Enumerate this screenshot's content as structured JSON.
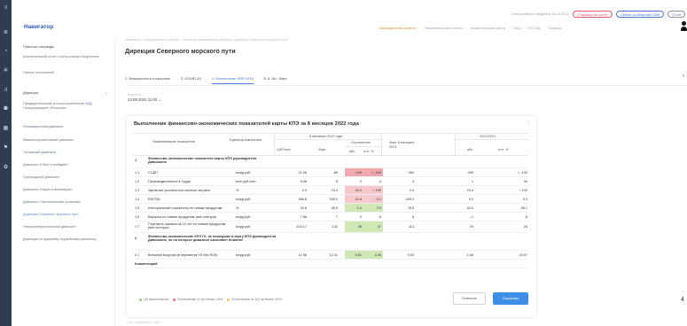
{
  "rail": {
    "icons": [
      "menu-icon",
      "list-icon",
      "pie-chart-icon",
      "cog-icon",
      "chart-icon",
      "people-icon",
      "dashboard-icon",
      "flag-icon",
      "settings-icon"
    ]
  },
  "header": {
    "status_text": "Оперативные сведения 18.10.2022",
    "pills": [
      "Отправка на успех",
      "Обмен сообщений СМИ",
      "Сооб"
    ],
    "app_title": "Навигатор",
    "nav": [
      "Операционный комитет",
      "Управленческие отчеты",
      "Аналитический центр",
      "ОКЦ",
      "ЕССЭД",
      "Помощь"
    ]
  },
  "sidebar": {
    "items": [
      "Повестка операнды",
      "Аналитический отчет о контрольных поручениях",
      "Панель отклонений",
      "Дирекции",
      "Предварительный прогноз исполнения ОЛД Госкорпорацией «Росатом»",
      "Инновационная дивизион",
      "Машиностроительный дивизион",
      "Топливный дивизион",
      "Дивизион «Сбыт и трейдинг»",
      "Горнорудный дивизион",
      "Дивизион «Наука и инновации»",
      "Дивизион «Экологические решения»",
      "Дирекция Северного морского пути",
      "Электроэнергетический дивизион",
      "Дирекция по ядерному оружейному комплексу"
    ]
  },
  "breadcrumb": "Навигатор  /  Операционный комитет  /  Основные направления бизнеса  /  Дирекция Северного морского пути",
  "page_title": "Дирекция Северного морского пути",
  "tabs": [
    "2. Безопасность и качество",
    "3. COVID-19",
    "4. Выполнение ФЭП КПЭ",
    "5. 6. 6А - Факт"
  ],
  "date": {
    "label": "Версия от",
    "value": "23.08.2022 11:00"
  },
  "card": {
    "title": "Выполнение финансово-экономических показателей карты КПЭ за 8 месяцев 2022 года",
    "headers": {
      "name": "Наименование показателя",
      "unit": "Единица измерения",
      "period": "8 месяцев 2022 года",
      "plan": "ЦЗ/План",
      "fact": "Факт",
      "deviation": "Отклонение",
      "abs": "абс.",
      "pct": "отн. %",
      "fact_prev": "Факт 8 месяцев 2021",
      "compare": "2022/2021",
      "abs2": "абс.",
      "pct2": "отн. %"
    },
    "rows": [
      {
        "idx": "1",
        "name": "Финансово-экономические показатели карты КПЭ руководителя Дивизиона",
        "section": true
      },
      {
        "idx": "1.1",
        "name": "ССДП",
        "unit": "млрд руб.",
        "plan": "21.08",
        "fact": "-89",
        "abs": "-109",
        "pct": "< -100",
        "prev": "360",
        "abs2": "-430",
        "pct2": "< -100"
      },
      {
        "idx": "1.2",
        "name": "Производительность труда",
        "unit": "млн руб./чел",
        "plan": "5.08",
        "fact": "5",
        "abs": "0",
        "pct": "-4",
        "prev": "4",
        "abs2": "1",
        "pct2": "34"
      },
      {
        "idx": "1.3",
        "name": "Удельные условно-постоянные затраты",
        "unit": "%",
        "plan": "0.0",
        "fact": "23.4",
        "abs": "23.4",
        "pct": "> 100",
        "prev": "0.0",
        "abs2": "23.4",
        "pct2": "> 100"
      },
      {
        "idx": "1.4",
        "name": "EBITDA",
        "unit": "млрд руб.",
        "plan": "356.8",
        "fact": "345.0",
        "abs": "-11.8",
        "pct": "-3.1",
        "prev": "345.0",
        "abs2": "0.0",
        "pct2": "0.0"
      },
      {
        "idx": "1.5",
        "name": "Интегральный показатель по новым продуктам",
        "unit": "%",
        "plan": "34.8",
        "fact": "35.5",
        "abs": "1.0",
        "pct": "2.9",
        "prev": "78.5",
        "abs2": "-43.0",
        "pct2": "-55.1"
      },
      {
        "idx": "1.6",
        "name": "Выручка по новым продуктам (вне контура)",
        "unit": "млрд руб.",
        "plan": "7.88",
        "fact": "7",
        "abs": "0",
        "pct": "-5",
        "prev": "8",
        "abs2": "-1",
        "pct2": "-6"
      },
      {
        "idx": "1.7",
        "name": "Портфель заказов на 10 лет по новым продуктам (вне контура)",
        "unit": "млрд руб.",
        "plan": "104.17",
        "fact": "142",
        "abs": "38",
        "pct": "37",
        "prev": "113",
        "abs2": "29",
        "pct2": "26"
      },
      {
        "idx": "2",
        "name": "Финансово-экономические КПЭ ГК, не вошедшие в карту КПЭ руководителя Дивизиона, но на которые дивизион оказывает влияние",
        "section": true
      },
      {
        "idx": "2.1",
        "name": "Внешняя выручка (в периметре ГК без ЯОК)",
        "unit": "млрд руб.",
        "plan": "11.98",
        "fact": "12.41",
        "abs": "0.51",
        "pct": "4.30",
        "prev": "9.93",
        "abs2": "2.48",
        "pct2": "24.97"
      }
    ],
    "comments_label": "Комментарий",
    "legend": [
      "ЦЗ выполняется",
      "Отклонение от ЦЗ более 10%",
      "Отклонение от ЦЗ не более 10%"
    ],
    "cancel_label": "Отменить",
    "save_label": "Сохранить"
  },
  "side_number": "4",
  "footer": "ОКЦ «Навигатор» 2022",
  "colors": {
    "accent": "#4a78d6",
    "red_cell": "#f6c9cc",
    "red_cell_strong": "#f0a9ae",
    "green_cell": "#cfe8b5",
    "save_button": "#3e8ee8"
  }
}
